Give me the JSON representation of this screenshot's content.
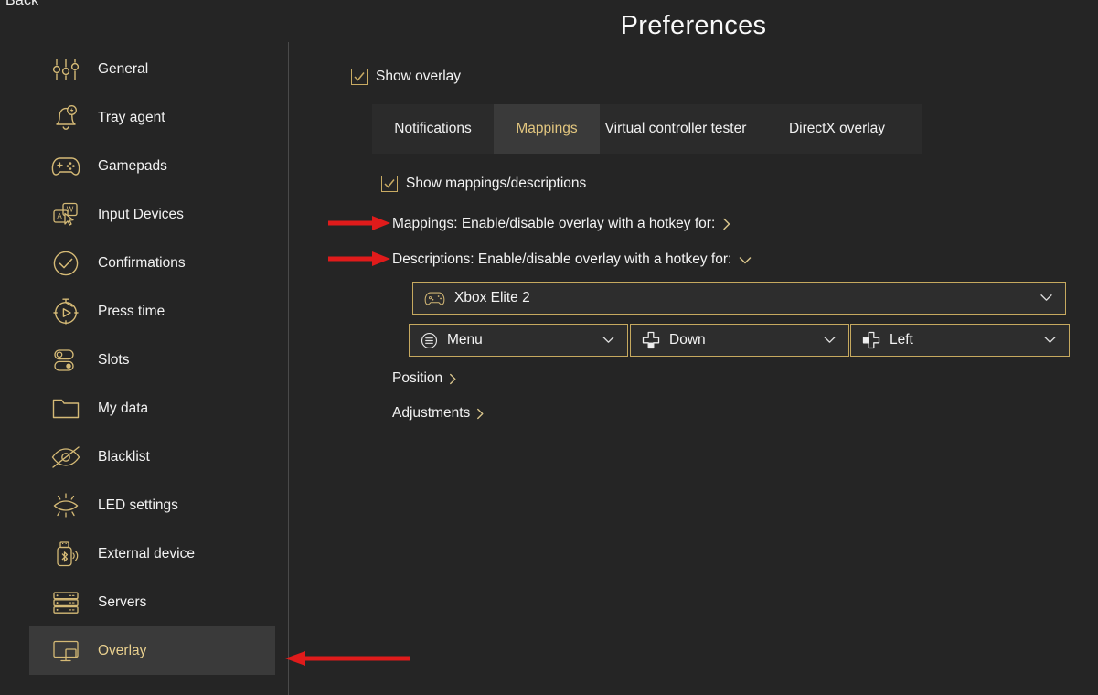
{
  "window": {
    "back_label": "Back",
    "title": "Preferences",
    "accent_gold": "#d9bd72",
    "bg": "#252525",
    "active_nav_bg": "#3a3a3a",
    "annotation_color": "#e01b1b"
  },
  "sidebar": {
    "items": [
      {
        "label": "General",
        "icon": "sliders-icon",
        "active": false
      },
      {
        "label": "Tray agent",
        "icon": "bell-bolt-icon",
        "active": false
      },
      {
        "label": "Gamepads",
        "icon": "gamepad-icon",
        "active": false
      },
      {
        "label": "Input Devices",
        "icon": "keyboard-cursor-icon",
        "active": false
      },
      {
        "label": "Confirmations",
        "icon": "check-circle-icon",
        "active": false
      },
      {
        "label": "Press time",
        "icon": "stopwatch-play-icon",
        "active": false
      },
      {
        "label": "Slots",
        "icon": "toggles-icon",
        "active": false
      },
      {
        "label": "My data",
        "icon": "folder-icon",
        "active": false
      },
      {
        "label": "Blacklist",
        "icon": "eye-slash-icon",
        "active": false
      },
      {
        "label": "LED settings",
        "icon": "led-light-icon",
        "active": false
      },
      {
        "label": "External device",
        "icon": "usb-bluetooth-icon",
        "active": false
      },
      {
        "label": "Servers",
        "icon": "servers-icon",
        "active": false
      },
      {
        "label": "Overlay",
        "icon": "monitor-overlay-icon",
        "active": true
      }
    ]
  },
  "main": {
    "show_overlay": {
      "label": "Show overlay",
      "checked": true
    },
    "tabs": [
      {
        "label": "Notifications",
        "active": false
      },
      {
        "label": "Mappings",
        "active": true
      },
      {
        "label": "Virtual controller tester",
        "active": false
      },
      {
        "label": "DirectX overlay",
        "active": false
      }
    ],
    "show_mappings": {
      "label": "Show mappings/descriptions",
      "checked": true
    },
    "hotkey_rows": [
      {
        "label": "Mappings: Enable/disable overlay with a hotkey for:",
        "chevron": "chevron-right-icon",
        "glyph": "›",
        "expanded": false
      },
      {
        "label": "Descriptions: Enable/disable overlay with a hotkey for:",
        "chevron": "chevron-down-icon",
        "glyph": "⌄",
        "expanded": true
      }
    ],
    "device_selector": {
      "value": "Xbox Elite 2",
      "icon": "gamepad-icon",
      "caret": "chevron-down-icon",
      "remove_glyph": "×"
    },
    "button_selectors": [
      {
        "value": "Menu",
        "icon": "menu-button-icon",
        "caret": "chevron-down-icon"
      },
      {
        "value": "Down",
        "icon": "dpad-down-icon",
        "caret": "chevron-down-icon"
      },
      {
        "value": "Left",
        "icon": "dpad-left-icon",
        "caret": "chevron-down-icon"
      }
    ],
    "sub_links": [
      {
        "label": "Position",
        "glyph": "›",
        "icon": "chevron-right-icon"
      },
      {
        "label": "Adjustments",
        "glyph": "›",
        "icon": "chevron-right-icon"
      }
    ]
  },
  "annotations": [
    {
      "name": "arrow-to-mappings-row",
      "direction": "right"
    },
    {
      "name": "arrow-to-descriptions-row",
      "direction": "right"
    },
    {
      "name": "arrow-to-overlay-nav",
      "direction": "left"
    }
  ]
}
